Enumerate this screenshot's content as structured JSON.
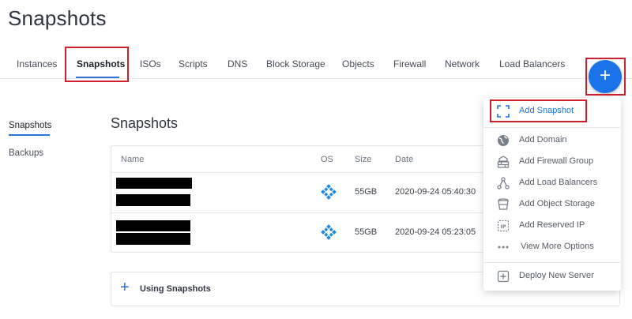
{
  "page": {
    "title": "Snapshots"
  },
  "tabs": [
    {
      "label": "Instances"
    },
    {
      "label": "Snapshots",
      "active": true
    },
    {
      "label": "ISOs"
    },
    {
      "label": "Scripts"
    },
    {
      "label": "DNS"
    },
    {
      "label": "Block Storage"
    },
    {
      "label": "Objects"
    },
    {
      "label": "Firewall"
    },
    {
      "label": "Network"
    },
    {
      "label": "Load Balancers"
    }
  ],
  "fab": {
    "label": "+"
  },
  "sidebar": {
    "items": [
      {
        "label": "Snapshots",
        "active": true
      },
      {
        "label": "Backups"
      }
    ]
  },
  "section": {
    "title": "Snapshots"
  },
  "table": {
    "columns": {
      "name": "Name",
      "os": "OS",
      "size": "Size",
      "date": "Date"
    },
    "rows": [
      {
        "size": "55GB",
        "date": "2020-09-24 05:40:30"
      },
      {
        "size": "55GB",
        "date": "2020-09-24 05:23:05"
      }
    ]
  },
  "using_snapshots": {
    "plus": "+",
    "label": "Using Snapshots"
  },
  "menu": {
    "add_snapshot": "Add Snapshot",
    "add_domain": "Add Domain",
    "add_firewall_group": "Add Firewall Group",
    "add_load_balancers": "Add Load Balancers",
    "add_object_storage": "Add Object Storage",
    "add_reserved_ip": "Add Reserved IP",
    "view_more_options": "View More Options",
    "deploy_new_server": "Deploy New Server"
  },
  "colors": {
    "accent": "#1a73e8",
    "highlight": "#d01f2d",
    "os_icon": "#1e88e5"
  }
}
